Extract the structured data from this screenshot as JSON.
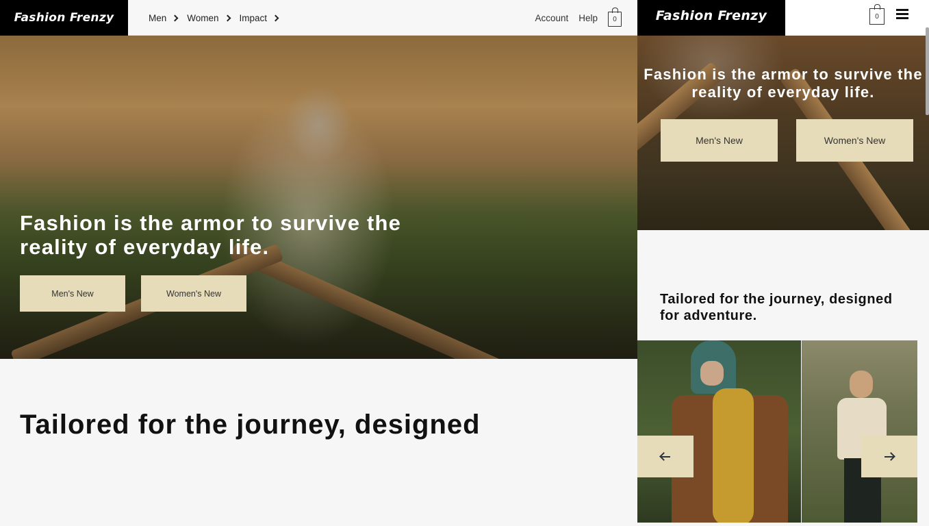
{
  "brand": {
    "name": "Fashion Frenzy"
  },
  "desktop": {
    "nav": [
      {
        "label": "Men"
      },
      {
        "label": "Women"
      },
      {
        "label": "Impact"
      }
    ],
    "utility": {
      "account": "Account",
      "help": "Help",
      "cart_count": "0"
    },
    "hero": {
      "title": "Fashion is the armor to survive the reality of everyday life.",
      "buttons": [
        {
          "label": "Men's New"
        },
        {
          "label": "Women's New"
        }
      ]
    },
    "tagline": "Tailored for the journey, designed"
  },
  "mobile": {
    "cart_count": "0",
    "hero": {
      "title": "Fashion is the armor to survive the reality of everyday life.",
      "buttons": [
        {
          "label": "Men's New"
        },
        {
          "label": "Women's New"
        }
      ]
    },
    "tagline": "Tailored for the journey, designed for adventure."
  },
  "colors": {
    "button_bg": "#e7dcb9",
    "logo_bg": "#000000",
    "page_bg": "#f6f6f6"
  },
  "icons": [
    "chevron-right-icon",
    "shopping-bag-icon",
    "hamburger-menu-icon",
    "arrow-left-icon",
    "arrow-right-icon"
  ]
}
